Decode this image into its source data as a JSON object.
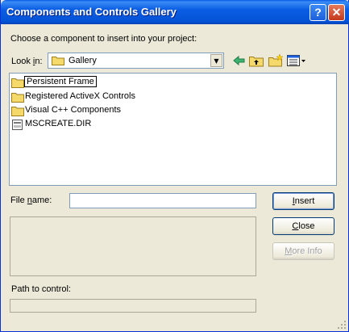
{
  "window": {
    "title": "Components and Controls Gallery",
    "help_glyph": "?",
    "close_glyph": "✕"
  },
  "prompt": "Choose a component to insert into your project:",
  "look_in": {
    "label_pre": "Look ",
    "label_u": "i",
    "label_post": "n:",
    "value": "Gallery"
  },
  "toolbar": {
    "back": "back-arrow-icon",
    "up": "up-one-level-icon",
    "new_folder": "new-folder-icon",
    "view_menu": "view-menu-icon"
  },
  "list": {
    "items": [
      {
        "label": "Persistent Frame",
        "icon": "folder-icon",
        "selected": true
      },
      {
        "label": "Registered ActiveX Controls",
        "icon": "folder-icon"
      },
      {
        "label": "Visual C++ Components",
        "icon": "folder-icon"
      },
      {
        "label": "MSCREATE.DIR",
        "icon": "file-icon"
      }
    ]
  },
  "file_name": {
    "label_pre": "File ",
    "label_u": "n",
    "label_post": "ame:",
    "value": ""
  },
  "path_label": "Path to control:",
  "buttons": {
    "insert_u": "I",
    "insert_rest": "nsert",
    "close_u": "C",
    "close_rest": "lose",
    "more_u": "M",
    "more_rest": "ore Info"
  },
  "colors": {
    "titlebar": "#0a5de3",
    "dialog_bg": "#ece9d8",
    "folder": "#f5d96b"
  }
}
